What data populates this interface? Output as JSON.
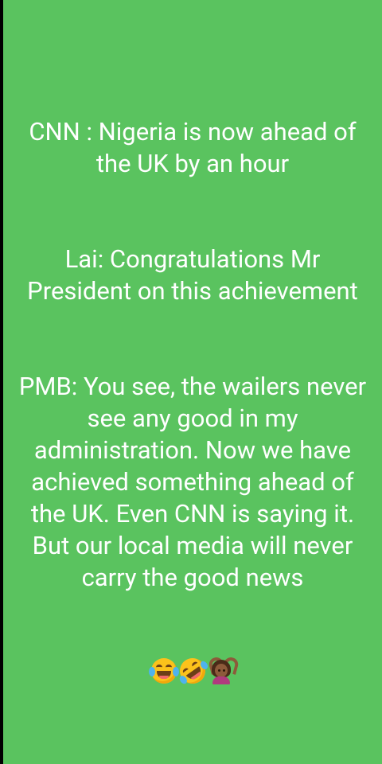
{
  "status": {
    "background_color": "#5ac35f",
    "text_color": "#ffffff",
    "paragraphs": [
      "CNN : Nigeria is now ahead of the UK by an hour",
      "Lai: Congratulations Mr President on this achievement",
      "PMB: You see, the wailers never see any good in my administration. Now we have achieved something ahead of the UK. Even CNN is saying it. But our local media will never carry the good news"
    ],
    "emojis": [
      {
        "icon": "face-with-tears-of-joy-icon",
        "char": "😂"
      },
      {
        "icon": "rolling-on-the-floor-laughing-icon",
        "char": "🤣"
      },
      {
        "icon": "person-gesturing-ok-icon",
        "char": "🙆🏾"
      }
    ]
  }
}
